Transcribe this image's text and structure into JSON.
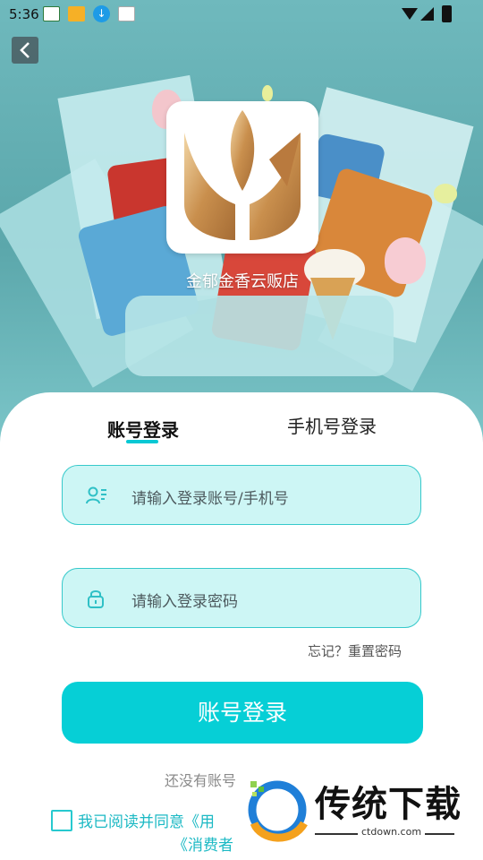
{
  "status_bar": {
    "time": "5:36"
  },
  "shop": {
    "name": "金郁金香云贩店"
  },
  "tabs": {
    "account": "账号登录",
    "phone": "手机号登录"
  },
  "form": {
    "account_placeholder": "请输入登录账号/手机号",
    "password_placeholder": "请输入登录密码",
    "forgot": "忘记？重置密码",
    "login_button": "账号登录",
    "register_hint": "还没有账号",
    "agreement_line1": "我已阅读并同意《用",
    "agreement_line2": "《消费者"
  },
  "watermark": {
    "title": "传统下载",
    "url": "ctdown.com"
  },
  "colors": {
    "accent": "#06cfd6",
    "field_bg": "#cdf6f5",
    "field_border": "#36c9cb",
    "agreement": "#1cb9c4"
  },
  "icons": [
    "chevron-left-icon",
    "user-icon",
    "lock-icon",
    "wifi-icon",
    "signal-icon",
    "battery-icon"
  ]
}
